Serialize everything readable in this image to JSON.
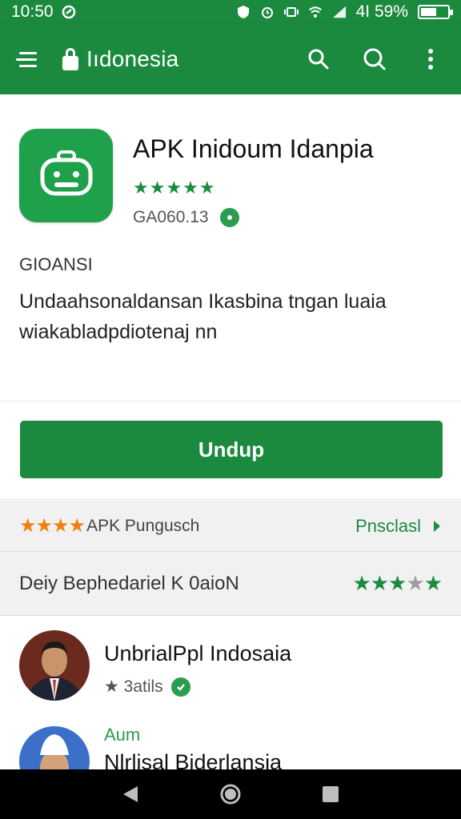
{
  "status_bar": {
    "time": "10:50",
    "battery": "4I 59%",
    "battery_level": 0.59
  },
  "app_bar": {
    "title": "Iıdonesia",
    "menu_icon": "menu-icon",
    "lock_icon": "lock-icon",
    "actions": [
      "search-icon",
      "search-icon",
      "more-vert-icon"
    ]
  },
  "app": {
    "name": "APK Inidoum Idanpia",
    "stars": "★★★★★",
    "meta": "GA060.13",
    "section_label": "GIOANSI",
    "description_lines": [
      "Undaahsonaldansan Ikasbina tngan luaia",
      "wiakabladpdiotenaj nn"
    ]
  },
  "download": {
    "label": "Undup"
  },
  "rating_row": {
    "stars": "★★★★",
    "label": "APK Pungusch",
    "link": "Pnsclasl"
  },
  "developer_row": {
    "label": "Deiy Bephedariel K 0aioN",
    "stars_full": "★★★",
    "stars_dim": "★",
    "stars_last": "★"
  },
  "list": {
    "items": [
      {
        "title": "UnbrialPpl Indosaia",
        "sub": "★ 3atils"
      },
      {
        "tag": "Aum",
        "title": "Nlrlisal Biderlansia"
      }
    ]
  },
  "colors": {
    "primary": "#1b8a3f",
    "accent_orange": "#f07e13",
    "icon_green": "#1fa04b"
  }
}
